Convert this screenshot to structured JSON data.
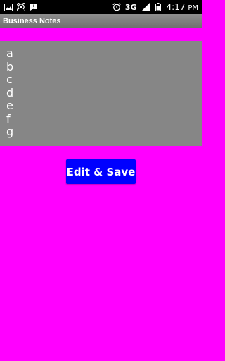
{
  "status_bar": {
    "network_type": "3G",
    "time": "4:17",
    "time_suffix": "PM",
    "icons": [
      "gallery-icon",
      "hotspot-icon",
      "alert-icon",
      "alarm-icon",
      "signal-icon",
      "battery-icon"
    ]
  },
  "app": {
    "title": "Business Notes"
  },
  "notes": {
    "lines": [
      "a",
      "b",
      "c",
      "d",
      "e",
      "f",
      "g"
    ]
  },
  "actions": {
    "edit_save_label": "Edit & Save",
    "button_color": "#0000ff"
  },
  "colors": {
    "background": "#ff00ff",
    "panel": "#868686",
    "title_bar": "#7f7f7f"
  }
}
